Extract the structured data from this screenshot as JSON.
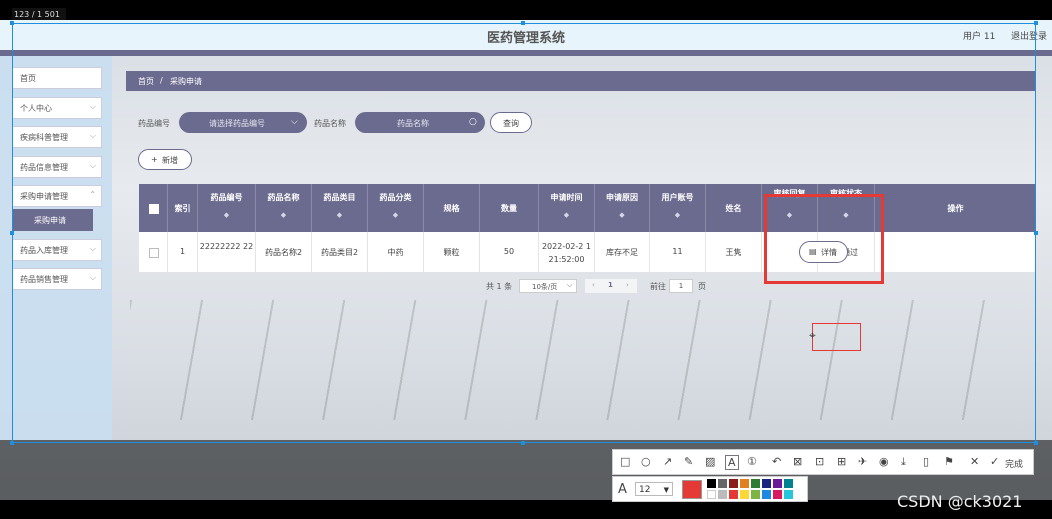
{
  "overlay": {
    "coordinate_text": "123 / 1 501"
  },
  "header": {
    "title": "医药管理系统",
    "user_label": "用户 11",
    "logout_label": "退出登录"
  },
  "sidebar": {
    "items": [
      {
        "label": "首页"
      },
      {
        "label": "个人中心"
      },
      {
        "label": "疾病科普管理"
      },
      {
        "label": "药品信息管理"
      },
      {
        "label": "采购申请管理"
      },
      {
        "label": "药品入库管理"
      },
      {
        "label": "药品销售管理"
      }
    ],
    "submenu_active": "采购申请"
  },
  "breadcrumb": {
    "home": "首页",
    "separator": "/",
    "current": "采购申请"
  },
  "filters": {
    "code_label": "药品编号",
    "code_placeholder": "请选择药品编号",
    "name_label": "药品名称",
    "name_placeholder": "药品名称",
    "query_button": "查询"
  },
  "add_button": "新增",
  "table": {
    "headers": [
      "索引",
      "药品编号",
      "药品名称",
      "药品类目",
      "药品分类",
      "规格",
      "数量",
      "申请时间",
      "申请原因",
      "用户账号",
      "姓名",
      "审核回复",
      "审核状态",
      "操作"
    ],
    "rows": [
      {
        "index": "1",
        "code": "22222222 22",
        "name": "药品名称2",
        "category": "药品类目2",
        "class": "中药",
        "spec": "颗粒",
        "qty": "50",
        "time": "2022-02-2 1 21:52:00",
        "reason": "库存不足",
        "account": "11",
        "person": "王隽",
        "reply": "",
        "status": "未通过",
        "action": "详情"
      }
    ]
  },
  "pagination": {
    "total": "共 1 条",
    "page_size": "10条/页",
    "current_page": "1",
    "goto_label": "前往",
    "goto_value": "1",
    "page_unit": "页"
  },
  "annotation_toolbar": {
    "done_label": "完成",
    "font_size": "12",
    "font_icon": "A"
  },
  "colors": {
    "accent": "#6b6b8f",
    "highlight": "#e53935",
    "selection": "#1e8fdc"
  },
  "watermark": "CSDN @ck3021"
}
